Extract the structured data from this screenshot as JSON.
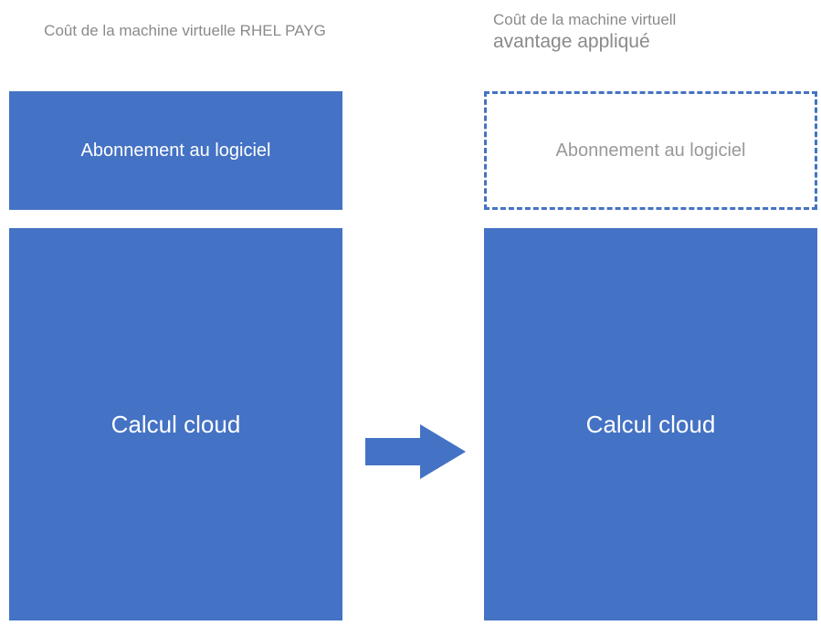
{
  "headers": {
    "left_title": "Coût de la machine virtuelle RHEL PAYG",
    "right_title_line1": "Coût de la machine virtuell",
    "right_title_line2": "avantage appliqué"
  },
  "boxes": {
    "subscription_label": "Abonnement au logiciel",
    "compute_label": "Calcul cloud"
  },
  "colors": {
    "primary": "#4472c4",
    "muted_text": "#8a8a8a"
  }
}
